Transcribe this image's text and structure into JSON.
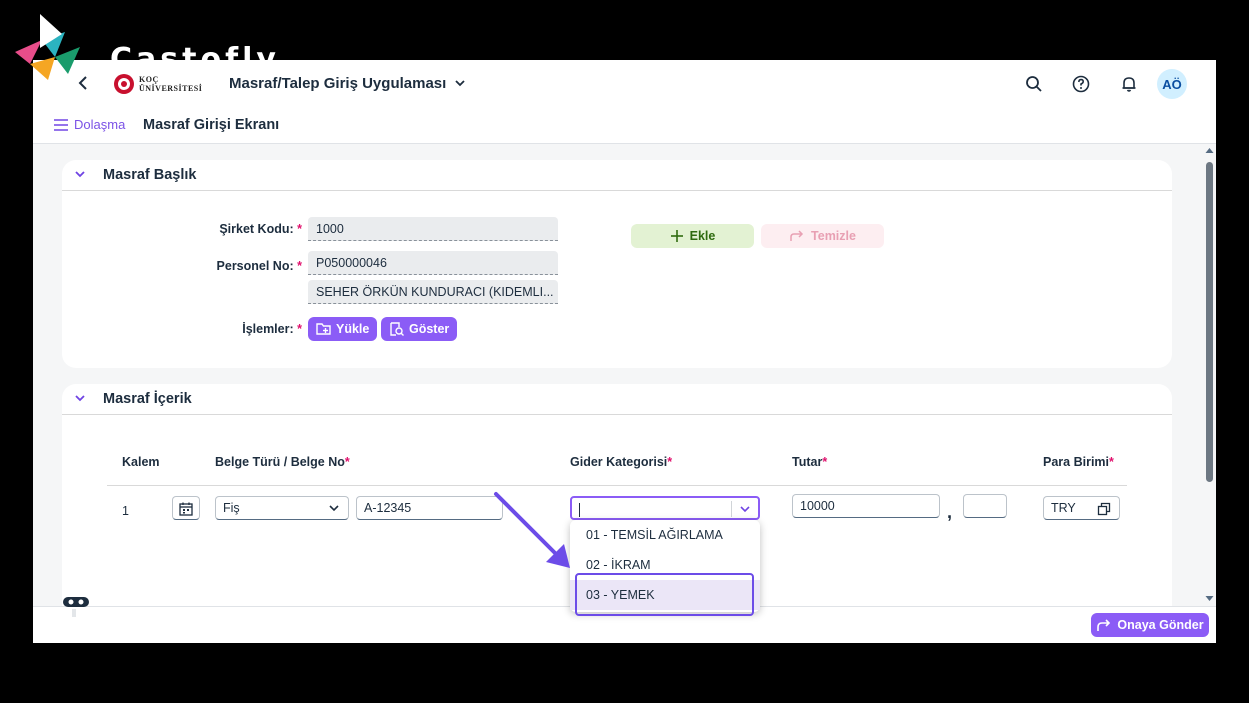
{
  "watermark": {
    "brand": "Castofly"
  },
  "shell": {
    "logo_line1": "KOÇ",
    "logo_line2": "ÜNİVERSİTESİ",
    "app_title": "Masraf/Talep Giriş Uygulaması",
    "avatar_initials": "AÖ"
  },
  "subheader": {
    "nav_label": "Dolaşma",
    "page_title": "Masraf Girişi Ekranı"
  },
  "header_panel": {
    "title": "Masraf Başlık",
    "company_code_label": "Şirket Kodu:",
    "company_code_value": "1000",
    "personnel_label": "Personel No:",
    "personnel_value": "P050000046",
    "personnel_name": "SEHER ÖRKÜN KUNDURACI (KIDEMLI...",
    "operations_label": "İşlemler:",
    "upload_label": "Yükle",
    "show_label": "Göster",
    "add_label": "Ekle",
    "clear_label": "Temizle",
    "required_mark": "*"
  },
  "content_panel": {
    "title": "Masraf İçerik",
    "columns": {
      "item": "Kalem",
      "doc": "Belge Türü / Belge No",
      "category": "Gider Kategorisi",
      "amount": "Tutar",
      "currency": "Para Birimi"
    },
    "row": {
      "item_no": "1",
      "doc_type": "Fiş",
      "doc_no": "A-12345",
      "category": "",
      "amount": "10000",
      "decimal_sep": ",",
      "decimals": "",
      "currency": "TRY"
    },
    "category_options": [
      "01 - TEMSİL AĞIRLAMA",
      "02 - İKRAM",
      "03 - YEMEK"
    ],
    "highlighted_option": "03 - YEMEK"
  },
  "footer": {
    "submit_label": "Onaya Gönder"
  },
  "colors": {
    "accent": "#8b5cf6",
    "required": "#e0106c",
    "add_bg": "#e3f2d3"
  }
}
